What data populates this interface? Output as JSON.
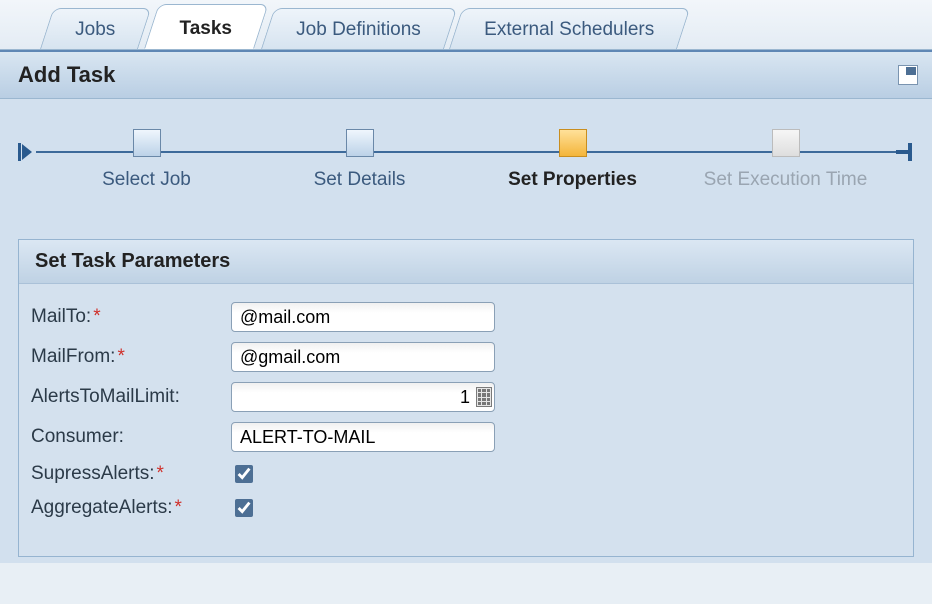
{
  "tabs": [
    {
      "label": "Jobs",
      "active": false
    },
    {
      "label": "Tasks",
      "active": true
    },
    {
      "label": "Job Definitions",
      "active": false
    },
    {
      "label": "External Schedulers",
      "active": false
    }
  ],
  "panel": {
    "title": "Add Task"
  },
  "wizard": {
    "steps": [
      {
        "label": "Select Job",
        "state": "done"
      },
      {
        "label": "Set  Details",
        "state": "done"
      },
      {
        "label": "Set Properties",
        "state": "current"
      },
      {
        "label": "Set Execution Time",
        "state": "future"
      }
    ]
  },
  "group": {
    "title": "Set Task Parameters"
  },
  "fields": {
    "mailto": {
      "label": "MailTo:",
      "required": true,
      "value": "@mail.com"
    },
    "mailfrom": {
      "label": "MailFrom:",
      "required": true,
      "value": "@gmail.com"
    },
    "alertslimit": {
      "label": "AlertsToMailLimit:",
      "required": false,
      "value": "1"
    },
    "consumer": {
      "label": "Consumer:",
      "required": false,
      "value": "ALERT-TO-MAIL"
    },
    "supress": {
      "label": "SupressAlerts:",
      "required": true,
      "checked": true
    },
    "aggregate": {
      "label": "AggregateAlerts:",
      "required": true,
      "checked": true
    }
  }
}
